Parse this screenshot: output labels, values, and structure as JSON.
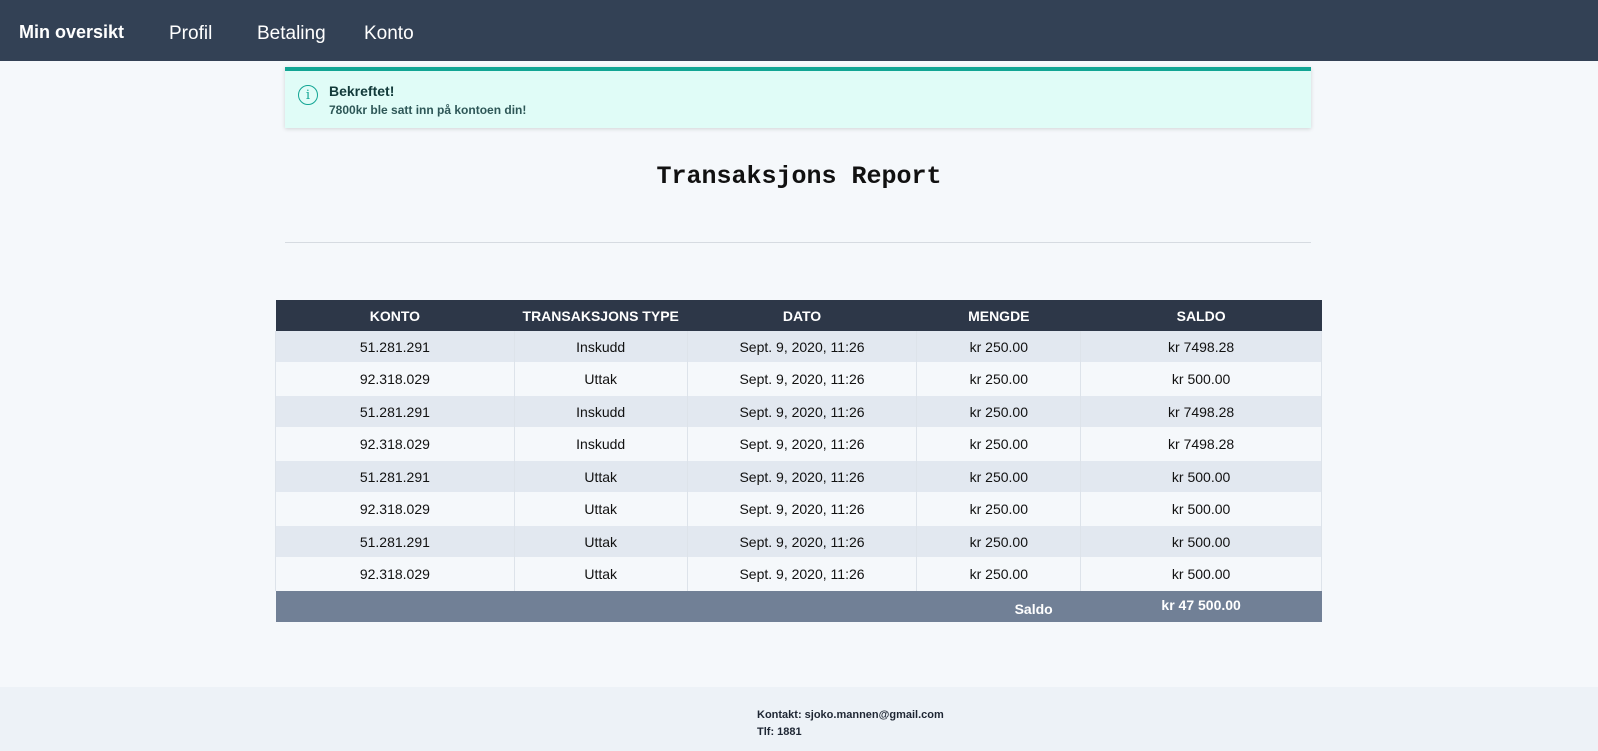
{
  "navbar": {
    "brand": "Min oversikt",
    "links": [
      "Profil",
      "Betaling",
      "Konto"
    ],
    "background": "#334155"
  },
  "alert": {
    "icon": "info-icon",
    "title": "Bekreftet!",
    "message": "7800kr ble satt inn på kontoen din!",
    "accent": "#12a594"
  },
  "report": {
    "title": "Transaksjons Report"
  },
  "table": {
    "headers": [
      "KONTO",
      "TRANSAKSJONS TYPE",
      "DATO",
      "MENGDE",
      "SALDO"
    ],
    "rows": [
      [
        "51.281.291",
        "Inskudd",
        "Sept. 9, 2020, 11:26",
        "kr 250.00",
        "kr 7498.28"
      ],
      [
        "92.318.029",
        "Uttak",
        "Sept. 9, 2020, 11:26",
        "kr 250.00",
        "kr 500.00"
      ],
      [
        "51.281.291",
        "Inskudd",
        "Sept. 9, 2020, 11:26",
        "kr 250.00",
        "kr 7498.28"
      ],
      [
        "92.318.029",
        "Inskudd",
        "Sept. 9, 2020, 11:26",
        "kr 250.00",
        "kr 7498.28"
      ],
      [
        "51.281.291",
        "Uttak",
        "Sept. 9, 2020, 11:26",
        "kr 250.00",
        "kr 500.00"
      ],
      [
        "92.318.029",
        "Uttak",
        "Sept. 9, 2020, 11:26",
        "kr 250.00",
        "kr 500.00"
      ],
      [
        "51.281.291",
        "Uttak",
        "Sept. 9, 2020, 11:26",
        "kr 250.00",
        "kr 500.00"
      ],
      [
        "92.318.029",
        "Uttak",
        "Sept. 9, 2020, 11:26",
        "kr 250.00",
        "kr 500.00"
      ]
    ],
    "total_label": "Saldo",
    "total_value": "kr 47 500.00"
  },
  "footer": {
    "contact": "Kontakt: sjoko.mannen@gmail.com",
    "phone": "Tlf: 1881"
  }
}
